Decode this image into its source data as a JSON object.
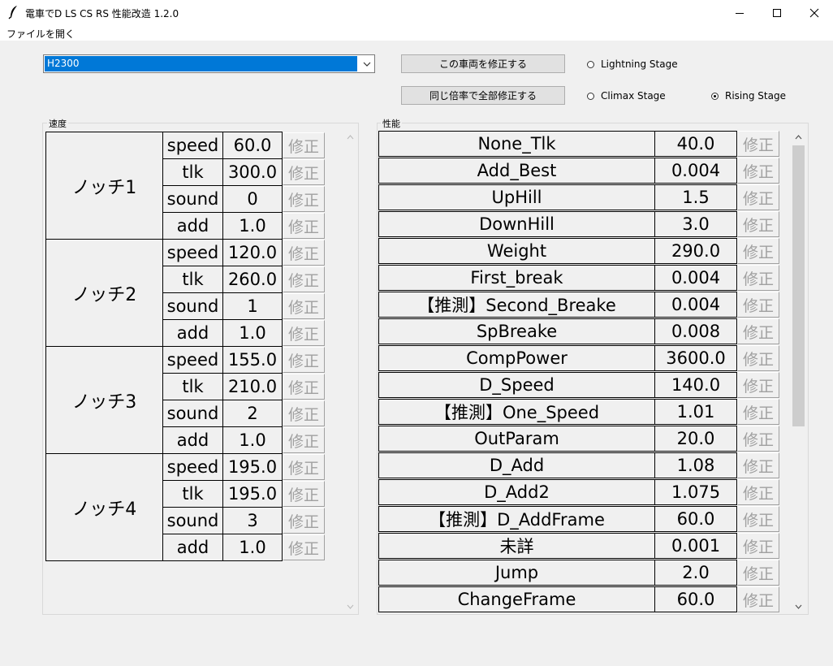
{
  "window": {
    "title": "電車でD LS CS RS 性能改造 1.2.0",
    "icon": "feather-icon"
  },
  "menu": {
    "file_open": "ファイルを開く"
  },
  "controls": {
    "vehicle_selected": "H2300",
    "modify_vehicle_button": "この車両を修正する",
    "modify_all_button": "同じ倍率で全部修正する",
    "stages": [
      {
        "label": "Lightning Stage",
        "checked": false
      },
      {
        "label": "Climax Stage",
        "checked": false
      },
      {
        "label": "Rising Stage",
        "checked": true
      }
    ]
  },
  "speed_section": {
    "label": "速度",
    "fix_label": "修正",
    "notches": [
      {
        "name": "ノッチ1",
        "rows": [
          {
            "key": "speed",
            "value": "60.0"
          },
          {
            "key": "tlk",
            "value": "300.0"
          },
          {
            "key": "sound",
            "value": "0"
          },
          {
            "key": "add",
            "value": "1.0"
          }
        ]
      },
      {
        "name": "ノッチ2",
        "rows": [
          {
            "key": "speed",
            "value": "120.0"
          },
          {
            "key": "tlk",
            "value": "260.0"
          },
          {
            "key": "sound",
            "value": "1"
          },
          {
            "key": "add",
            "value": "1.0"
          }
        ]
      },
      {
        "name": "ノッチ3",
        "rows": [
          {
            "key": "speed",
            "value": "155.0"
          },
          {
            "key": "tlk",
            "value": "210.0"
          },
          {
            "key": "sound",
            "value": "2"
          },
          {
            "key": "add",
            "value": "1.0"
          }
        ]
      },
      {
        "name": "ノッチ4",
        "rows": [
          {
            "key": "speed",
            "value": "195.0"
          },
          {
            "key": "tlk",
            "value": "195.0"
          },
          {
            "key": "sound",
            "value": "3"
          },
          {
            "key": "add",
            "value": "1.0"
          }
        ]
      }
    ]
  },
  "performance_section": {
    "label": "性能",
    "fix_label": "修正",
    "rows": [
      {
        "name": "None_Tlk",
        "value": "40.0"
      },
      {
        "name": "Add_Best",
        "value": "0.004"
      },
      {
        "name": "UpHill",
        "value": "1.5"
      },
      {
        "name": "DownHill",
        "value": "3.0"
      },
      {
        "name": "Weight",
        "value": "290.0"
      },
      {
        "name": "First_break",
        "value": "0.004"
      },
      {
        "name": "【推測】Second_Breake",
        "value": "0.004"
      },
      {
        "name": "SpBreake",
        "value": "0.008"
      },
      {
        "name": "CompPower",
        "value": "3600.0"
      },
      {
        "name": "D_Speed",
        "value": "140.0"
      },
      {
        "name": "【推測】One_Speed",
        "value": "1.01"
      },
      {
        "name": "OutParam",
        "value": "20.0"
      },
      {
        "name": "D_Add",
        "value": "1.08"
      },
      {
        "name": "D_Add2",
        "value": "1.075"
      },
      {
        "name": "【推測】D_AddFrame",
        "value": "60.0"
      },
      {
        "name": "未詳",
        "value": "0.001"
      },
      {
        "name": "Jump",
        "value": "2.0"
      },
      {
        "name": "ChangeFrame",
        "value": "60.0"
      }
    ]
  }
}
